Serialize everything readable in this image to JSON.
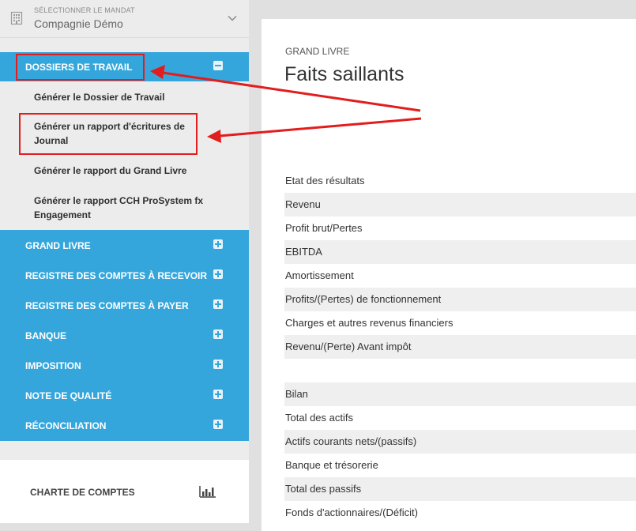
{
  "mandate": {
    "label": "SÉLECTIONNER LE MANDAT",
    "value": "Compagnie Démo"
  },
  "sidebar": {
    "dossiers": {
      "label": "DOSSIERS DE TRAVAIL",
      "items": [
        "Générer le Dossier de Travail",
        "Générer un rapport d'écritures de Journal",
        "Générer le rapport du Grand Livre",
        "Générer le rapport CCH ProSystem fx Engagement"
      ]
    },
    "sections": [
      "GRAND LIVRE",
      "REGISTRE DES COMPTES À RECEVOIR",
      "REGISTRE DES COMPTES À PAYER",
      "BANQUE",
      "IMPOSITION",
      "NOTE DE QUALITÉ",
      "RÉCONCILIATION"
    ],
    "charte": "CHARTE DE COMPTES"
  },
  "main": {
    "crumb": "GRAND LIVRE",
    "title": "Faits saillants",
    "rows": [
      "Etat des résultats",
      "Revenu",
      "Profit brut/Pertes",
      "EBITDA",
      "Amortissement",
      "Profits/(Pertes) de fonctionnement",
      "Charges et autres revenus financiers",
      "Revenu/(Perte) Avant impôt",
      "",
      "Bilan",
      "Total des actifs",
      "Actifs courants nets/(passifs)",
      "Banque et trésorerie",
      "Total des passifs",
      "Fonds d'actionnaires/(Déficit)"
    ]
  },
  "colors": {
    "accent": "#35a6dc",
    "highlight": "#e21d1d"
  }
}
